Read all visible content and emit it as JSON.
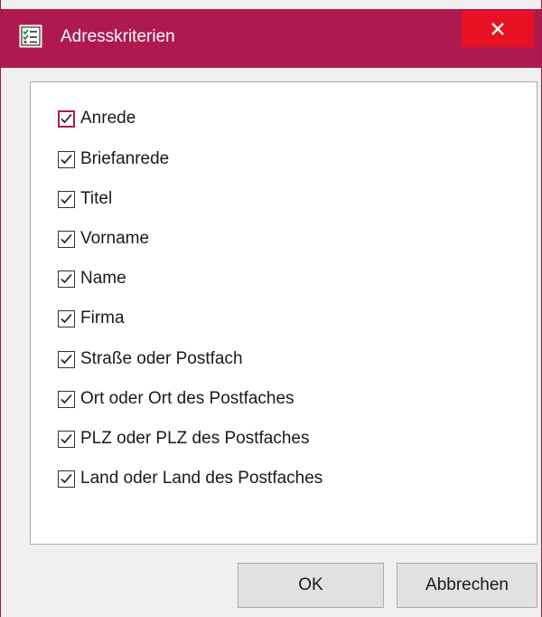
{
  "window": {
    "title": "Adresskriterien",
    "icon": "checklist-icon",
    "accent_color": "#ae1a4f",
    "close_color": "#e81123",
    "close_icon": "close-icon"
  },
  "criteria": [
    {
      "label": "Anrede",
      "checked": true,
      "focused": true
    },
    {
      "label": "Briefanrede",
      "checked": true
    },
    {
      "label": "Titel",
      "checked": true
    },
    {
      "label": "Vorname",
      "checked": true
    },
    {
      "label": "Name",
      "checked": true
    },
    {
      "label": "Firma",
      "checked": true
    },
    {
      "label": "Straße oder Postfach",
      "checked": true
    },
    {
      "label": "Ort oder Ort des Postfaches",
      "checked": true
    },
    {
      "label": "PLZ oder PLZ des Postfaches",
      "checked": true
    },
    {
      "label": "Land oder Land des Postfaches",
      "checked": true
    }
  ],
  "buttons": {
    "ok_label": "OK",
    "cancel_label": "Abbrechen"
  }
}
